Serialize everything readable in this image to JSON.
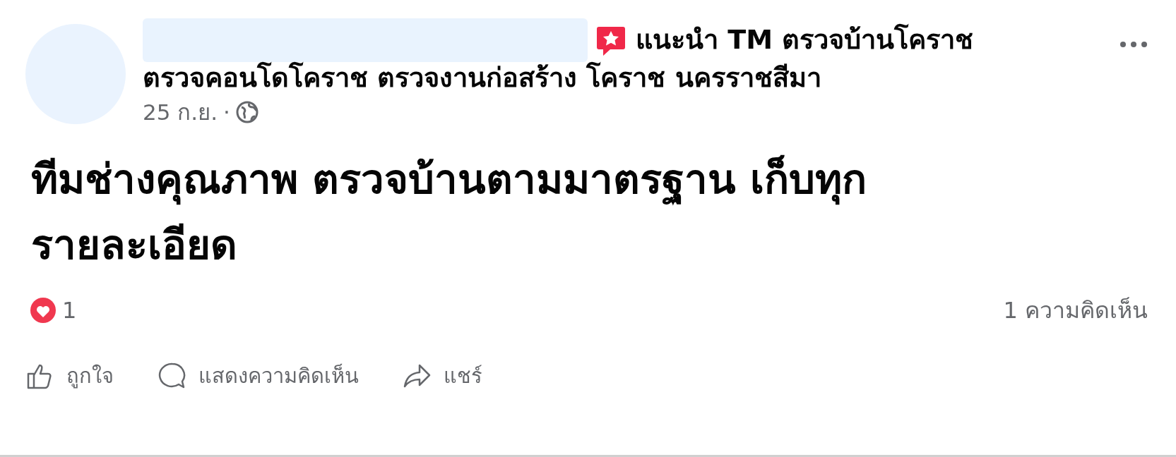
{
  "post": {
    "page_label": "แนะนำ TM ตรวจบ้านโคราช",
    "page_subtitle": "ตรวจคอนโดโคราช ตรวจงานก่อสร้าง โคราช นครราชสีมา",
    "date": "25 ก.ย.",
    "separator": "·",
    "text": "ทีมช่างคุณภาพ ตรวจบ้านตามมาตรฐาน เก็บทุก รายละเอียด",
    "reaction_count": "1",
    "comment_count": "1 ความคิดเห็น",
    "actions": [
      {
        "kind": "like",
        "label": "ถูกใจ"
      },
      {
        "kind": "comment",
        "label": "แสดงความคิดเห็น"
      },
      {
        "kind": "share",
        "label": "แชร์"
      }
    ]
  }
}
